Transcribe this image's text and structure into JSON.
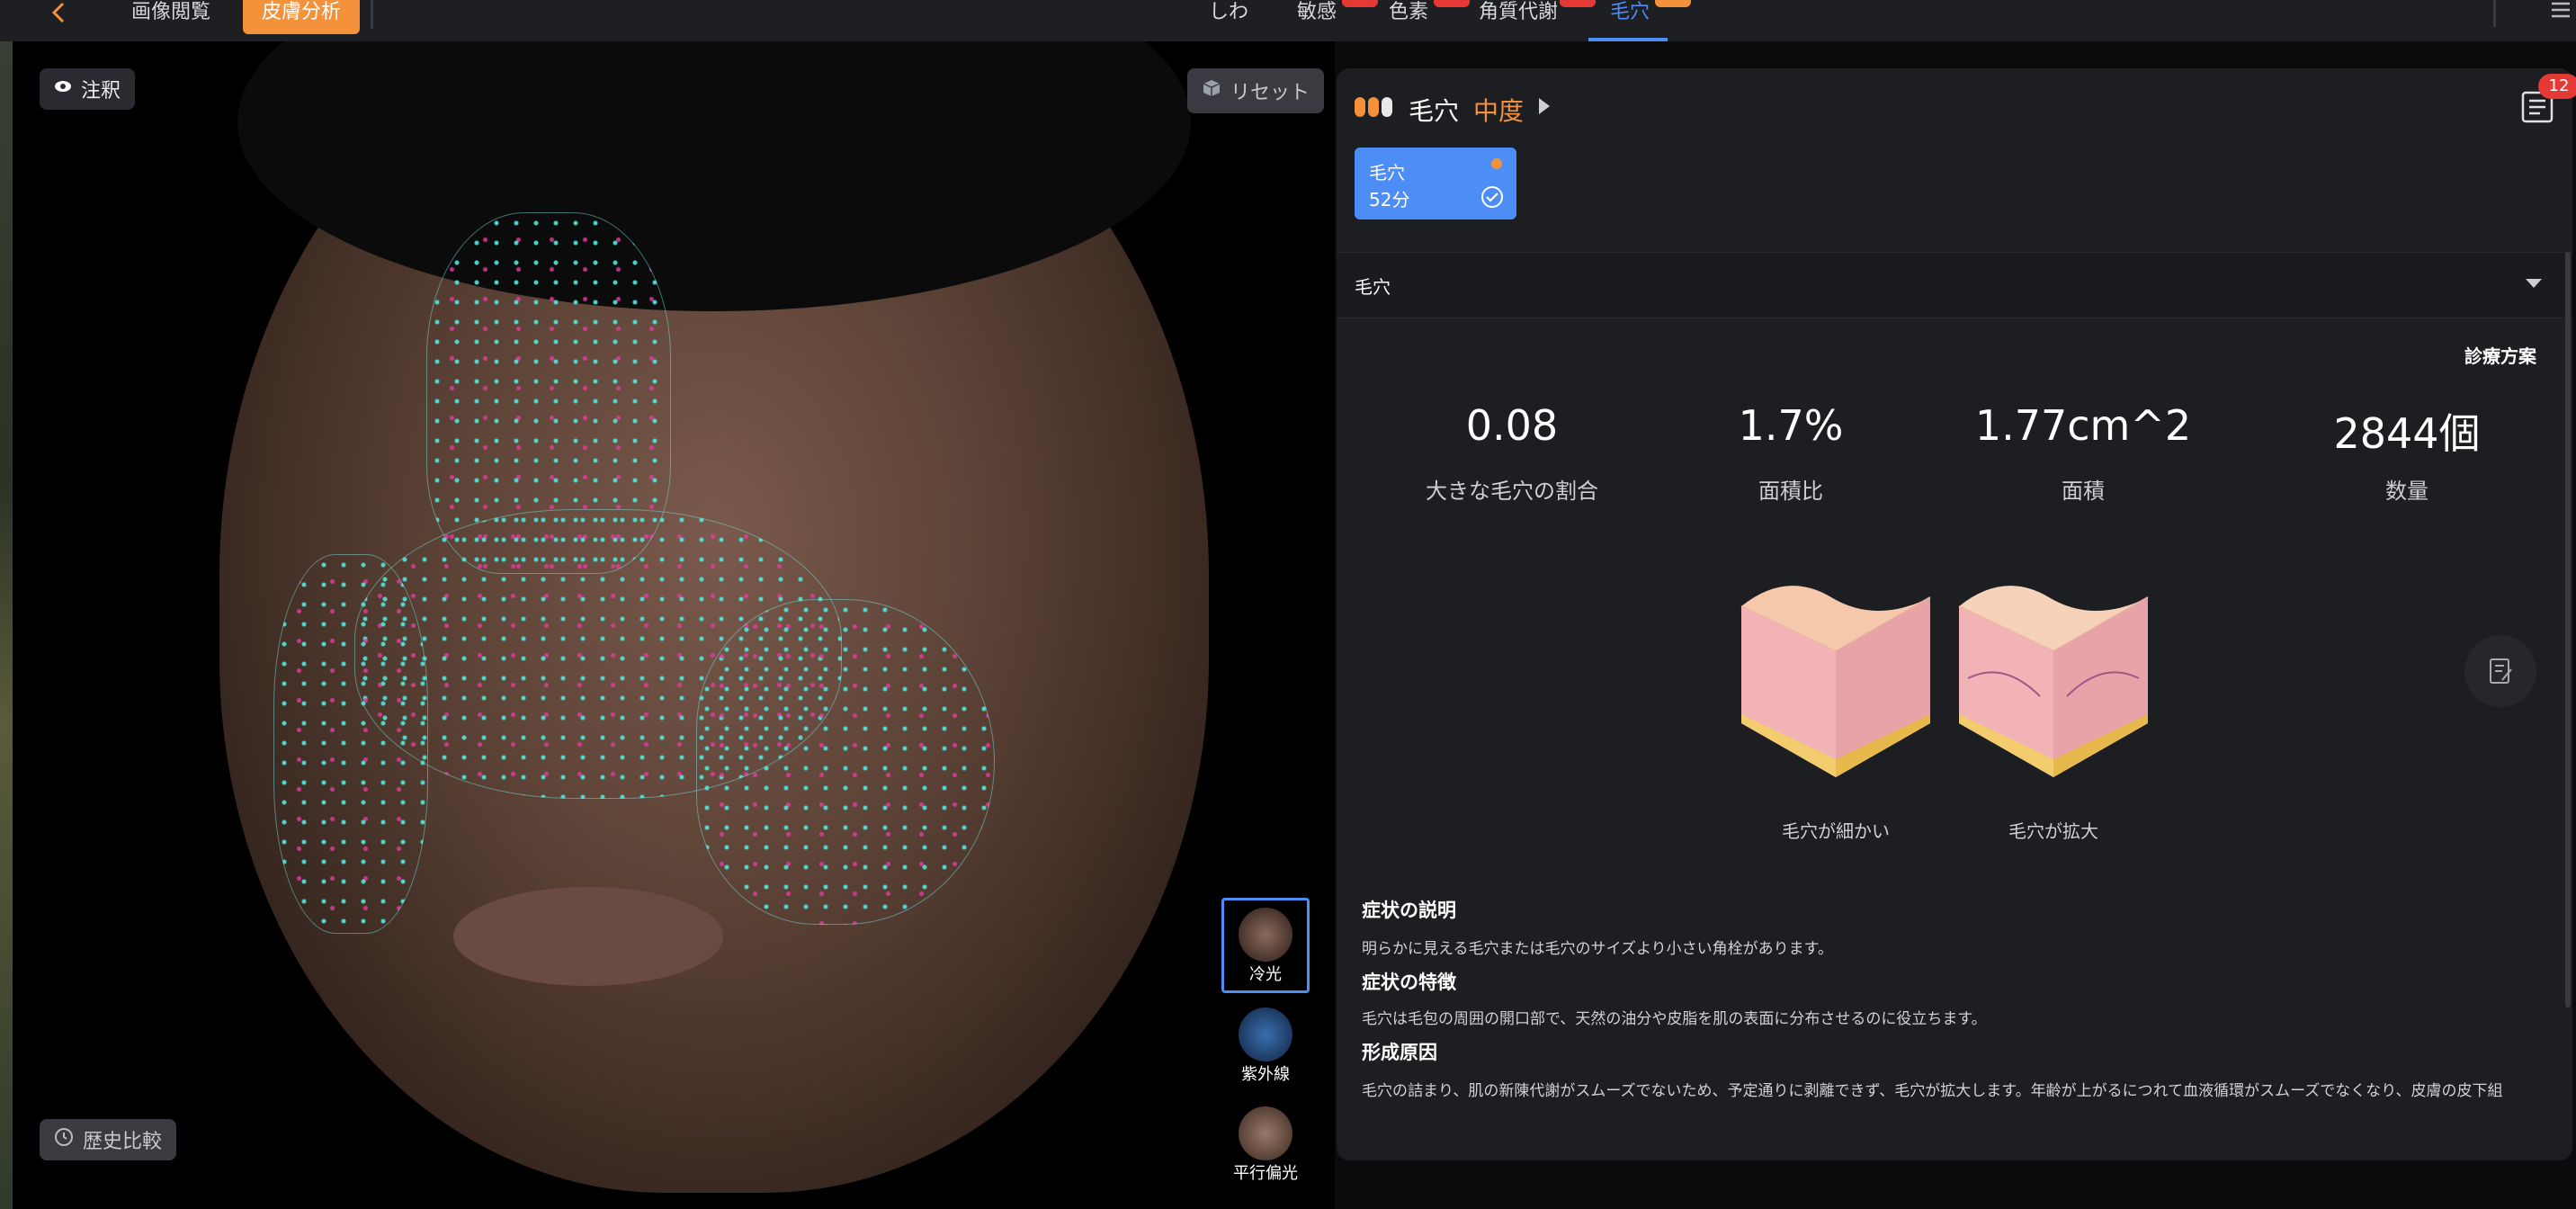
{
  "topbar": {
    "back_icon": "chevron-left-icon",
    "tabs_left": [
      {
        "label": "画像閲覧"
      },
      {
        "label": "皮膚分析"
      }
    ],
    "tabs_center": [
      {
        "label": "しわ"
      },
      {
        "label": "敏感"
      },
      {
        "label": "色素"
      },
      {
        "label": "角質代謝"
      },
      {
        "label": "毛穴"
      }
    ],
    "menu_icon": "hamburger-icon",
    "accent": "#f3923a",
    "active_color": "#4d8df6"
  },
  "viewer": {
    "annotation_label": "注釈",
    "reset_label": "リセット",
    "history_label": "歴史比較",
    "thumbnails": [
      {
        "label": "冷光"
      },
      {
        "label": "紫外線"
      },
      {
        "label": "平行偏光"
      }
    ]
  },
  "panel": {
    "title": "毛穴",
    "severity": "中度",
    "report_badge": "12",
    "score_card": {
      "name": "毛穴",
      "score": "52分"
    },
    "dropdown_label": "毛穴",
    "treatment_link": "診療方案",
    "metrics": [
      {
        "value": "0.08",
        "label": "大きな毛穴の割合"
      },
      {
        "value": "1.7%",
        "label": "面積比"
      },
      {
        "value": "1.77cm^2",
        "label": "面積"
      },
      {
        "value": "2844個",
        "label": "数量"
      }
    ],
    "illustrations": [
      {
        "label": "毛穴が細かい"
      },
      {
        "label": "毛穴が拡大"
      }
    ],
    "sections": [
      {
        "heading": "症状の説明",
        "text": "明らかに見える毛穴または毛穴のサイズより小さい角栓があります。"
      },
      {
        "heading": "症状の特徴",
        "text": "毛穴は毛包の周囲の開口部で、天然の油分や皮脂を肌の表面に分布させるのに役立ちます。"
      },
      {
        "heading": "形成原因",
        "text": "毛穴の詰まり、肌の新陳代謝がスムーズでないため、予定通りに剥離できず、毛穴が拡大します。年齢が上がるにつれて血液循環がスムーズでなくなり、皮膚の皮下組"
      }
    ]
  }
}
